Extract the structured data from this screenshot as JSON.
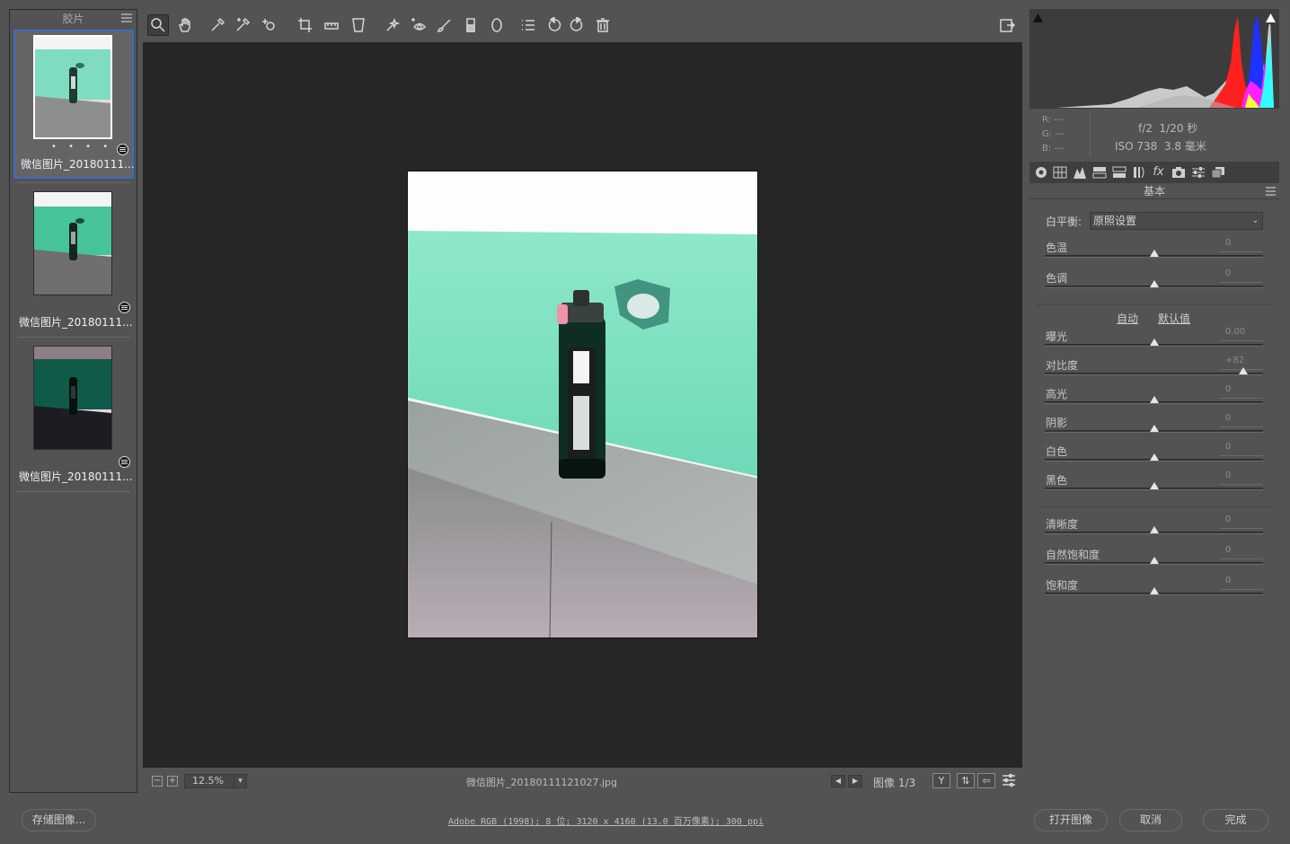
{
  "filmstrip": {
    "title": "胶片",
    "items": [
      {
        "name": "微信图片_20180111...",
        "selected": true,
        "dots": "• • • • •"
      },
      {
        "name": "微信图片_20180111...",
        "selected": false
      },
      {
        "name": "微信图片_20180111...",
        "selected": false
      }
    ]
  },
  "toolbar": {
    "tools": [
      "zoom-tool",
      "hand-tool",
      "white-balance-tool",
      "color-sampler-tool",
      "targeted-adjustment-tool",
      "crop-tool",
      "straighten-tool",
      "transform-tool",
      "spot-removal-tool",
      "red-eye-removal-tool",
      "adjustment-brush-tool",
      "graduated-filter-tool",
      "radial-filter-tool",
      "preferences-list",
      "rotate-left",
      "rotate-right",
      "trash"
    ]
  },
  "statusbar": {
    "zoom_minus": "−",
    "zoom_plus": "+",
    "zoom_value": "12.5%",
    "filename": "微信图片_20180111121027.jpg",
    "image_count": "图像 1/3"
  },
  "histogram": {
    "r_label": "R:",
    "g_label": "G:",
    "b_label": "B:",
    "dash": "---",
    "aperture_shutter": "f/2  1/20 秒",
    "iso_focal": "ISO 738  3.8 毫米"
  },
  "panel": {
    "title": "基本",
    "wb_label": "白平衡:",
    "wb_value": "原照设置",
    "auto_link": "自动",
    "default_link": "默认值",
    "sliders_wb": [
      {
        "label": "色温",
        "value": "0",
        "position": 0.5
      },
      {
        "label": "色调",
        "value": "0",
        "position": 0.5
      }
    ],
    "sliders_tone": [
      {
        "label": "曝光",
        "value": "0.00",
        "position": 0.5
      },
      {
        "label": "对比度",
        "value": "+82",
        "position": 0.91
      },
      {
        "label": "高光",
        "value": "0",
        "position": 0.5
      },
      {
        "label": "阴影",
        "value": "0",
        "position": 0.5
      },
      {
        "label": "白色",
        "value": "0",
        "position": 0.5
      },
      {
        "label": "黑色",
        "value": "0",
        "position": 0.5
      }
    ],
    "sliders_presence": [
      {
        "label": "清晰度",
        "value": "0",
        "position": 0.5
      },
      {
        "label": "自然饱和度",
        "value": "0",
        "position": 0.5
      },
      {
        "label": "饱和度",
        "value": "0",
        "position": 0.5
      }
    ]
  },
  "bottom": {
    "save_label": "存储图像...",
    "color_info": "Adobe RGB (1998); 8 位; 3120 x 4160 (13.0 百万像素); 300 ppi",
    "open_label": "打开图像",
    "cancel_label": "取消",
    "done_label": "完成"
  }
}
